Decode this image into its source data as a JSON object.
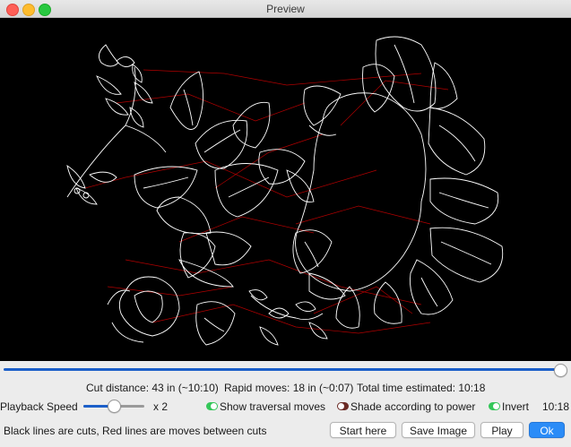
{
  "window": {
    "title": "Preview"
  },
  "preview": {
    "background": "#000000",
    "cut_line_color": "#ffffff",
    "move_line_color": "#b00000",
    "description": "Floral line-art cut path preview"
  },
  "playback": {
    "position_fraction": 1.0
  },
  "stats": {
    "cut_distance": "Cut distance: 43 in (~10:10)",
    "rapid_moves": "Rapid moves: 18 in (~0:07)",
    "total_time": "Total time estimated: 10:18"
  },
  "controls": {
    "playback_speed_label": "Playback Speed",
    "speed_multiplier": "x 2",
    "speed_fraction": 0.5,
    "show_traversal": {
      "label": "Show traversal moves",
      "checked": true
    },
    "shade_power": {
      "label": "Shade according to power",
      "checked": false
    },
    "invert": {
      "label": "Invert",
      "checked": true
    },
    "elapsed_time": "10:18"
  },
  "footer": {
    "note": "Black lines are cuts, Red lines are moves between cuts",
    "buttons": {
      "start_here": "Start here",
      "save_image": "Save Image",
      "play": "Play",
      "ok": "Ok"
    }
  },
  "colors": {
    "accent": "#2b8cf7",
    "slider": "#1c5fc9"
  }
}
